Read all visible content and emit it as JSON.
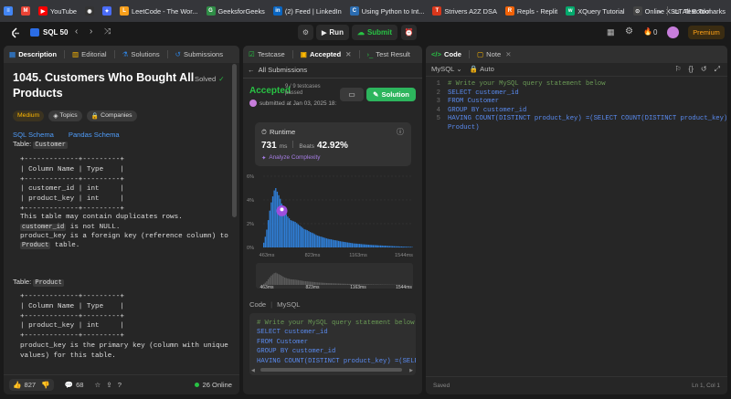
{
  "bookmarks": [
    {
      "label": "",
      "color": "#4285f4",
      "glyph": "≡"
    },
    {
      "label": "",
      "color": "#ea4335",
      "glyph": "M"
    },
    {
      "label": "YouTube",
      "color": "#ff0000",
      "glyph": "▶"
    },
    {
      "label": "",
      "color": "#333",
      "glyph": "◉"
    },
    {
      "label": "",
      "color": "#4a6cf7",
      "glyph": "✦"
    },
    {
      "label": "LeetCode - The Wor...",
      "color": "#f89f1b",
      "glyph": "L"
    },
    {
      "label": "GeeksforGeeks",
      "color": "#2f8d46",
      "glyph": "G"
    },
    {
      "label": "(2) Feed | LinkedIn",
      "color": "#0a66c2",
      "glyph": "in"
    },
    {
      "label": "Using Python to Int...",
      "color": "#2b6cb0",
      "glyph": "C"
    },
    {
      "label": "Strivers A2Z DSA",
      "color": "#d9371b",
      "glyph": "T"
    },
    {
      "label": "Repls - Replit",
      "color": "#f26207",
      "glyph": "R"
    },
    {
      "label": "XQuery Tutorial",
      "color": "#04aa6d",
      "glyph": "w"
    },
    {
      "label": "Online XSLT Test Tool",
      "color": "#444",
      "glyph": "⊙"
    }
  ],
  "bookmarks_more": "»",
  "all_bookmarks": "All Bookmarks",
  "nav": {
    "title": "SQL 50",
    "run": "Run",
    "submit": "Submit",
    "notifications": "0",
    "premium": "Premium"
  },
  "left": {
    "tabs": {
      "description": "Description",
      "editorial": "Editorial",
      "solutions": "Solutions",
      "submissions": "Submissions"
    },
    "title": "1045. Customers Who Bought All Products",
    "solved": "Solved",
    "tags": {
      "difficulty": "Medium",
      "topics": "Topics",
      "companies": "Companies"
    },
    "schema_sql": "SQL Schema",
    "schema_pandas": "Pandas Schema",
    "table1_prefix": "Table: ",
    "table1_name": "Customer",
    "table1_ascii": "+-------------+---------+\n| Column Name | Type    |\n+-------------+---------+\n| customer_id | int     |\n| product_key | int     |\n+-------------+---------+",
    "p1": "This table may contain duplicates rows.",
    "p2_code": "customer_id",
    "p2_text": " is not NULL.",
    "p3": "product_key is a foreign key (reference column) to",
    "p3_code": "Product",
    "p3_tail": " table.",
    "table2_prefix": "Table: ",
    "table2_name": "Product",
    "table2_ascii": "+-------------+---------+\n| Column Name | Type    |\n+-------------+---------+\n| product_key | int     |\n+-------------+---------+",
    "p4": "product_key is the primary key (column with unique values) for this table.",
    "likes": "827",
    "comments": "68",
    "online": "26 Online"
  },
  "middle": {
    "tabs": {
      "testcase": "Testcase",
      "accepted": "Accepted",
      "result": "Test Result"
    },
    "back": "All Submissions",
    "status": "Accepted",
    "passed": "9 / 9 testcases passed",
    "submitted": "submitted at Jan 03, 2025 18:",
    "solution_btn": "Solution",
    "runtime_label": "Runtime",
    "runtime_value": "731",
    "runtime_unit": "ms",
    "beats_label": "Beats",
    "beats_value": "42.92%",
    "analyze": "Analyze Complexity",
    "chart_data": {
      "type": "bar",
      "ylabels": [
        "6%",
        "4%",
        "2%",
        "0%"
      ],
      "xlabels": [
        "463ms",
        "823ms",
        "1163ms",
        "1544ms"
      ],
      "mini_xlabels": [
        "463ms",
        "823ms",
        "1163ms",
        "1544ms"
      ],
      "values": [
        0.4,
        0.9,
        1.5,
        2.3,
        3.1,
        3.8,
        4.3,
        4.8,
        5.0,
        4.7,
        4.4,
        4.1,
        3.7,
        3.4,
        3.0,
        2.8,
        2.6,
        2.45,
        2.3,
        2.25,
        2.2,
        2.15,
        2.05,
        1.95,
        1.85,
        1.75,
        1.65,
        1.55,
        1.5,
        1.45,
        1.38,
        1.3,
        1.25,
        1.2,
        1.12,
        1.05,
        1.0,
        0.95,
        0.92,
        0.88,
        0.84,
        0.8,
        0.76,
        0.72,
        0.7,
        0.68,
        0.65,
        0.62,
        0.6,
        0.58,
        0.55,
        0.52,
        0.5,
        0.48,
        0.46,
        0.44,
        0.42,
        0.4,
        0.38,
        0.36,
        0.34,
        0.33,
        0.32,
        0.31,
        0.3,
        0.28,
        0.27,
        0.26,
        0.25,
        0.24,
        0.23,
        0.22,
        0.21,
        0.2,
        0.2,
        0.19,
        0.18,
        0.17,
        0.17,
        0.16,
        0.15,
        0.15,
        0.14,
        0.13,
        0.12,
        0.12,
        0.11,
        0.1,
        0.1,
        0.09,
        0.09,
        0.08,
        0.08,
        0.07,
        0.07,
        0.06,
        0.06,
        0.05,
        0.05,
        0.04
      ],
      "ylim": [
        0,
        6
      ],
      "highlight_index": 12,
      "colors": {
        "bar": "#2f7fd8",
        "highlight": "#9d4edd"
      }
    },
    "code_label": "Code",
    "code_lang": "MySQL",
    "code_lines": [
      "# Write your MySQL query statement below",
      "SELECT customer_id",
      "FROM Customer",
      "GROUP BY customer_id",
      "HAVING  COUNT(DISTINCT product_key) =(SELECT"
    ]
  },
  "editor": {
    "tabs": {
      "code": "Code",
      "note": "Note"
    },
    "lang": "MySQL",
    "auto": "Auto",
    "lines": [
      {
        "n": "1",
        "t": "# Write your MySQL query statement below",
        "c": "cm"
      },
      {
        "n": "2",
        "t": "SELECT customer_id",
        "c": "sql"
      },
      {
        "n": "3",
        "t": "FROM Customer",
        "c": "sql"
      },
      {
        "n": "4",
        "t": "GROUP BY customer_id",
        "c": "sql"
      },
      {
        "n": "5",
        "t": "HAVING  COUNT(DISTINCT product_key) =(SELECT COUNT(DISTINCT product_key) FROM",
        "c": "sql"
      },
      {
        "n": "",
        "t": "Product)",
        "c": "sql"
      }
    ],
    "status_left": "Saved",
    "status_right": "Ln 1, Col 1"
  }
}
